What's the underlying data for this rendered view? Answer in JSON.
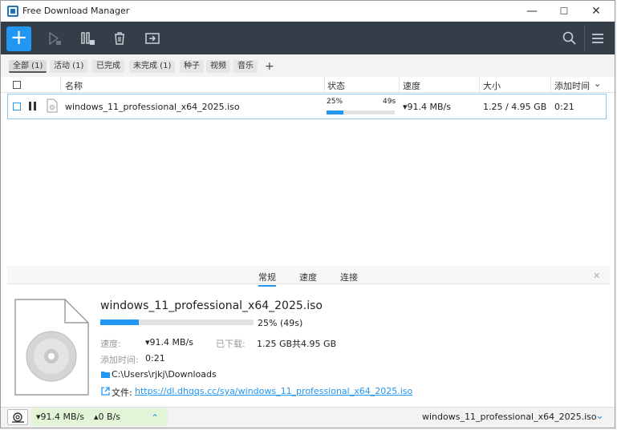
{
  "window": {
    "title": "Free Download Manager",
    "minimize": "—",
    "maximize": "☐",
    "close": "✕"
  },
  "toolbar": {
    "add": "+"
  },
  "filters": [
    {
      "label": "全部 (1)",
      "active": true
    },
    {
      "label": "活动 (1)"
    },
    {
      "label": "已完成"
    },
    {
      "label": "未完成 (1)"
    },
    {
      "label": "种子"
    },
    {
      "label": "视频"
    },
    {
      "label": "音乐"
    },
    {
      "label": "+"
    }
  ],
  "table": {
    "headers": {
      "name": "名称",
      "status": "状态",
      "speed": "速度",
      "size": "大小",
      "added": "添加时间",
      "sort_indicator": "⌄"
    },
    "rows": [
      {
        "name": "windows_11_professional_x64_2025.iso",
        "percent_text": "25%",
        "time_left": "49s",
        "progress": 0.25,
        "speed": "▾91.4 MB/s",
        "size": "1.25 / 4.95 GB",
        "added": "0:21"
      }
    ]
  },
  "details": {
    "tabs": [
      "常规",
      "速度",
      "连接"
    ],
    "active_tab": "常规",
    "file_name": "windows_11_professional_x64_2025.iso",
    "progress": 0.25,
    "progress_text": "25% (49s)",
    "speed_label": "速度:",
    "speed_value": "▾91.4 MB/s",
    "downloaded_label": "已下载:",
    "downloaded_value": "1.25 GB共4.95 GB",
    "added_label": "添加时间:",
    "added_value": "0:21",
    "folder": "C:\\Users\\rjkj\\Downloads",
    "file_label": "文件:",
    "file_url": "https://dl.dhqqs.cc/sya/windows_11_professional_x64_2025.iso",
    "close": "✕"
  },
  "statusbar": {
    "down_speed": "▾91.4 MB/s",
    "up_speed": "▴0 B/s",
    "expand": "⌃",
    "current_file": "windows_11_professional_x64_2025.iso",
    "dropdown": "⌄"
  },
  "colors": {
    "accent": "#2196f3",
    "toolbar": "#343e49",
    "selection_border": "#8fc6ef",
    "speed_box": "#e3f5d7"
  }
}
